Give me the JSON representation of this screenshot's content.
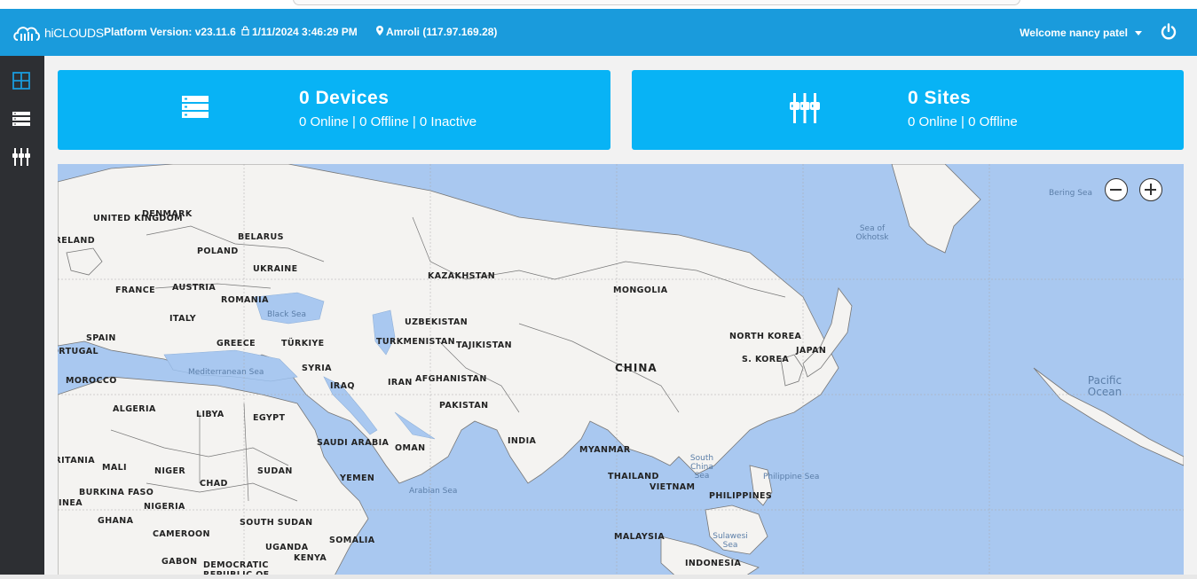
{
  "header": {
    "logo_text": "hiCLOUDS",
    "platform_version": "Platform Version: v23.11.6",
    "datetime": "1/11/2024 3:46:29 PM",
    "location": "Amroli (117.97.169.28)",
    "welcome": "Welcome nancy patel",
    "colors": {
      "header": "#1a9bdc",
      "card": "#08b3f5",
      "sidebar": "#2d2f33"
    }
  },
  "sidebar": {
    "items": [
      {
        "icon": "dashboard-grid-icon",
        "active": true
      },
      {
        "icon": "devices-list-icon",
        "active": false
      },
      {
        "icon": "sites-equalizer-icon",
        "active": false
      }
    ]
  },
  "cards": {
    "devices": {
      "title": "0 Devices",
      "subtitle": "0 Online | 0 Offline | 0 Inactive",
      "icon": "server-stack-icon"
    },
    "sites": {
      "title": "0 Sites",
      "subtitle": "0 Online | 0 Offline",
      "icon": "sites-equalizer-icon"
    }
  },
  "map": {
    "countries": [
      "UNITED KINGDOM",
      "DENMARK",
      "IRELAND",
      "BELARUS",
      "POLAND",
      "UKRAINE",
      "FRANCE",
      "AUSTRIA",
      "ROMANIA",
      "ITALY",
      "SPAIN",
      "PORTUGAL",
      "GREECE",
      "TÜRKIYE",
      "MOROCCO",
      "ALGERIA",
      "LIBYA",
      "EGYPT",
      "SYRIA",
      "IRAQ",
      "IRAN",
      "AFGHANISTAN",
      "PAKISTAN",
      "KAZAKHSTAN",
      "UZBEKISTAN",
      "TURKMENISTAN",
      "TAJIKISTAN",
      "MONGOLIA",
      "CHINA",
      "NORTH KOREA",
      "S. KOREA",
      "JAPAN",
      "INDIA",
      "SAUDI ARABIA",
      "OMAN",
      "YEMEN",
      "MAURITANIA",
      "MALI",
      "NIGER",
      "CHAD",
      "SUDAN",
      "BURKINA FASO",
      "GUINEA",
      "NIGERIA",
      "GHANA",
      "CAMEROON",
      "SOUTH SUDAN",
      "SOMALIA",
      "UGANDA",
      "KENYA",
      "GABON",
      "DEMOCRATIC REPUBLIC OF",
      "MYANMAR",
      "THAILAND",
      "VIETNAM",
      "PHILIPPINES",
      "MALAYSIA",
      "INDONESIA"
    ],
    "seas": {
      "black": "Black Sea",
      "med": "Mediterranean Sea",
      "arabian": "Arabian Sea",
      "south_china": "South China Sea",
      "philippine": "Philippine Sea",
      "sulawesi": "Sulawesi Sea",
      "okhotsk": "Sea of Okhotsk",
      "bering": "Bering Sea",
      "pacific": "Pacific Ocean"
    }
  }
}
